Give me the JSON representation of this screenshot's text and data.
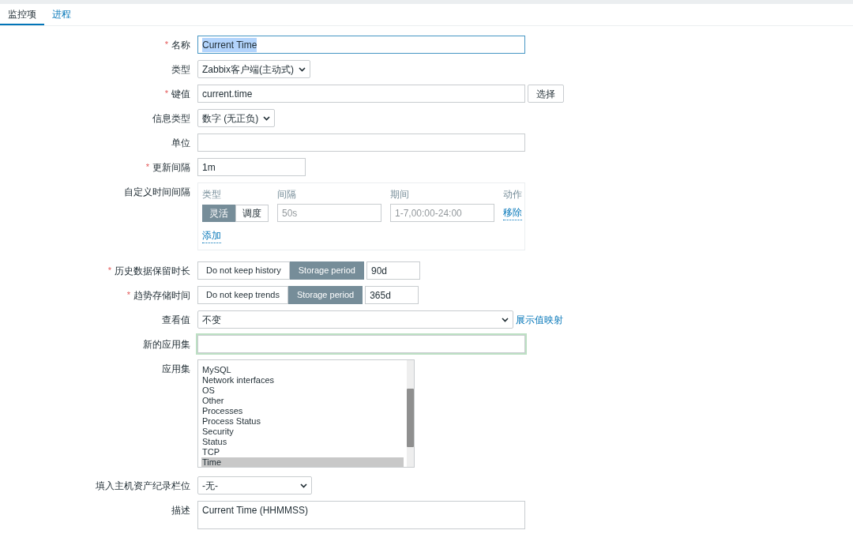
{
  "tabs": [
    {
      "label": "监控项",
      "selected": true
    },
    {
      "label": "进程",
      "selected": false
    }
  ],
  "form": {
    "name": {
      "label": "名称",
      "required_mark": "*",
      "value": "Current Time",
      "value_selected": true
    },
    "type": {
      "label": "类型",
      "value": "Zabbix客户端(主动式)"
    },
    "key": {
      "label": "键值",
      "required_mark": "*",
      "value": "current.time",
      "button": "选择"
    },
    "info_type": {
      "label": "信息类型",
      "value": "数字 (无正负)"
    },
    "units": {
      "label": "单位"
    },
    "update_interval": {
      "label": "更新间隔",
      "required_mark": "*",
      "value": "1m"
    },
    "custom_intervals": {
      "label": "自定义时间间隔",
      "columns": [
        "类型",
        "间隔",
        "期间",
        "动作"
      ],
      "rows": [
        {
          "modes": [
            {
              "label": "灵活",
              "selected": true
            },
            {
              "label": "调度",
              "selected": false
            }
          ],
          "interval_placeholder": "50s",
          "period_placeholder": "1-7,00:00-24:00",
          "action": "移除"
        }
      ],
      "add": "添加"
    },
    "history": {
      "label": "历史数据保留时长",
      "required_mark": "*",
      "options": [
        {
          "label": "Do not keep history",
          "selected": false
        },
        {
          "label": "Storage period",
          "selected": true
        }
      ],
      "value": "90d"
    },
    "trends": {
      "label": "趋势存储时间",
      "required_mark": "*",
      "options": [
        {
          "label": "Do not keep trends",
          "selected": false
        },
        {
          "label": "Storage period",
          "selected": true
        }
      ],
      "value": "365d"
    },
    "show_value": {
      "label": "查看值",
      "value": "不变",
      "link": "展示值映射"
    },
    "new_application": {
      "label": "新的应用集"
    },
    "applications": {
      "label": "应用集",
      "items": [
        {
          "label": "MySQL",
          "selected": false
        },
        {
          "label": "Network interfaces",
          "selected": false
        },
        {
          "label": "OS",
          "selected": false
        },
        {
          "label": "Other",
          "selected": false
        },
        {
          "label": "Processes",
          "selected": false
        },
        {
          "label": "Process Status",
          "selected": false
        },
        {
          "label": "Security",
          "selected": false
        },
        {
          "label": "Status",
          "selected": false
        },
        {
          "label": "TCP",
          "selected": false
        },
        {
          "label": "Time",
          "selected": true
        }
      ]
    },
    "inventory": {
      "label": "填入主机资产纪录栏位",
      "value": "-无-"
    },
    "description": {
      "label": "描述",
      "value": "Current Time (HHMMSS)"
    }
  }
}
